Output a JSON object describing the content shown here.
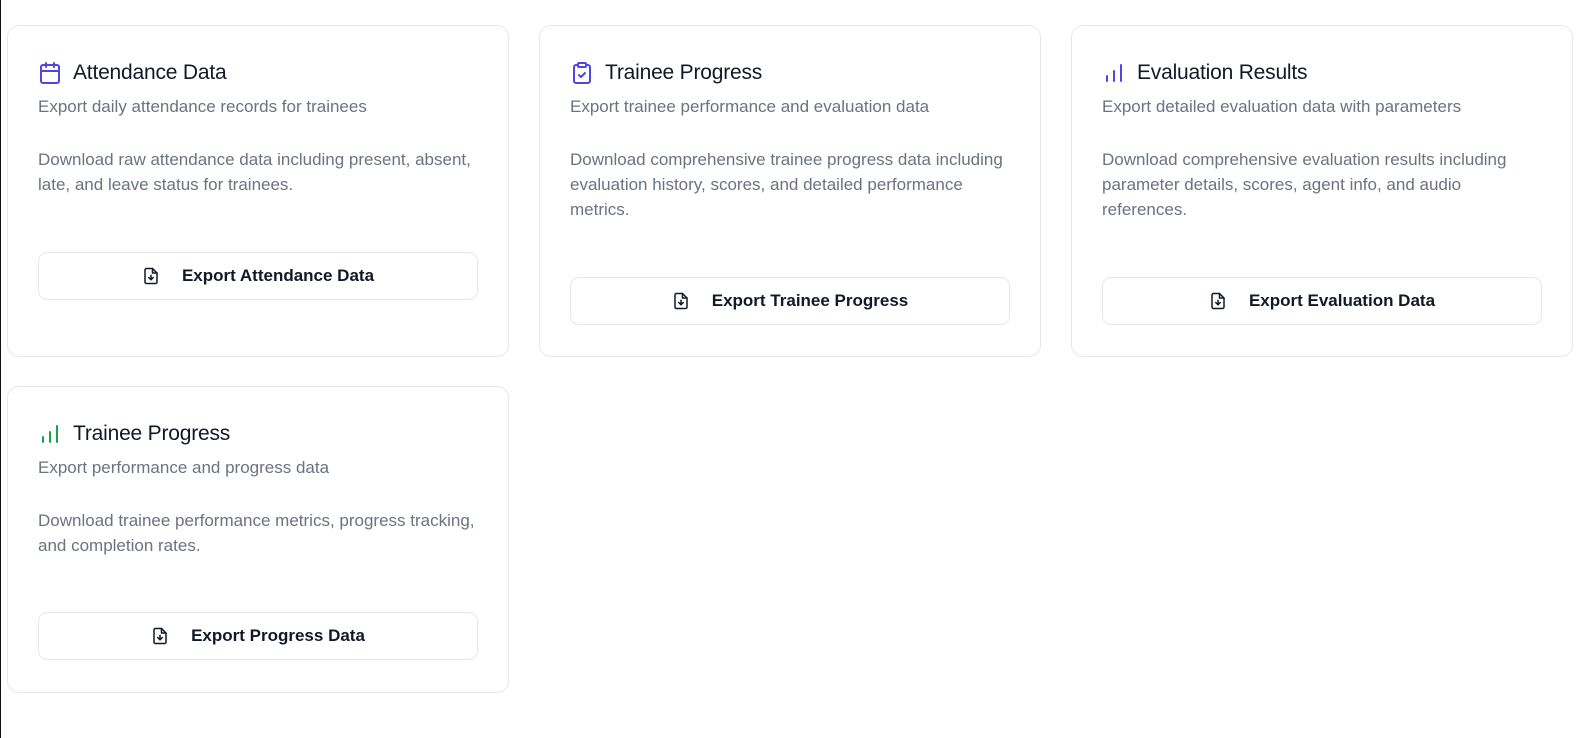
{
  "cards": [
    {
      "title": "Attendance Data",
      "icon": "calendar-icon",
      "subtitle": "Export daily attendance records for trainees",
      "description": "Download raw attendance data including present, absent, late, and leave status for trainees.",
      "button_label": "Export Attendance Data"
    },
    {
      "title": "Trainee Progress",
      "icon": "clipboard-check-icon",
      "subtitle": "Export trainee performance and evaluation data",
      "description": "Download comprehensive trainee progress data including evaluation history, scores, and detailed performance metrics.",
      "button_label": "Export Trainee Progress"
    },
    {
      "title": "Evaluation Results",
      "icon": "bar-chart-icon",
      "subtitle": "Export detailed evaluation data with parameters",
      "description": "Download comprehensive evaluation results including parameter details, scores, agent info, and audio references.",
      "button_label": "Export Evaluation Data"
    },
    {
      "title": "Trainee Progress",
      "icon": "bar-chart-icon",
      "subtitle": "Export performance and progress data",
      "description": "Download trainee performance metrics, progress tracking, and completion rates.",
      "button_label": "Export Progress Data"
    }
  ],
  "colors": {
    "accent_indigo": "#4f46e5",
    "accent_green": "#16a34a",
    "border": "#e5e7eb",
    "muted_text": "#6b7280",
    "title_text": "#111827"
  },
  "button_icon": "file-download-icon"
}
